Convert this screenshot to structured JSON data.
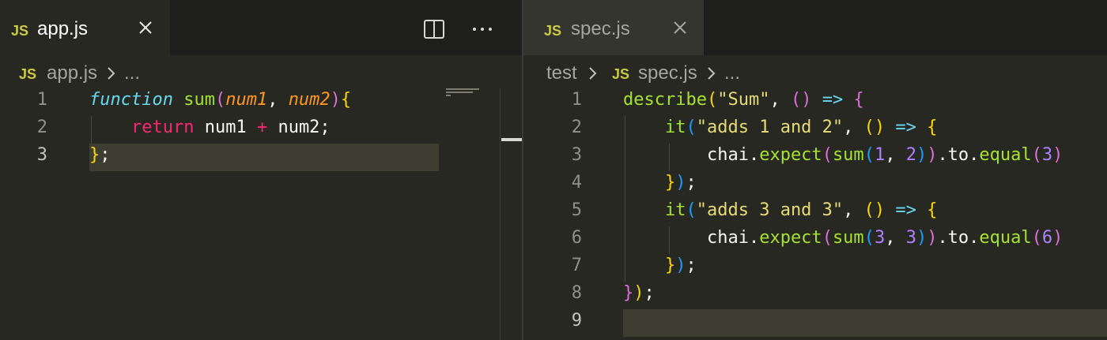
{
  "colors": {
    "editor_bg": "#272822",
    "tab_bar_bg": "#1e1f1c",
    "js_badge": "#cbcb41",
    "current_line": "#3e3d32"
  },
  "left": {
    "tab": {
      "badge": "JS",
      "title": "app.js",
      "close_icon": "close-icon"
    },
    "actions": {
      "split": "split-editor-icon",
      "more": "more-actions-icon"
    },
    "breadcrumb": {
      "badge": "JS",
      "file": "app.js",
      "ellipsis": "..."
    },
    "line_numbers": [
      "1",
      "2",
      "3"
    ],
    "code": {
      "l1": {
        "kw": "function",
        "name": " sum",
        "open": "(",
        "p1": "num1",
        "comma": ", ",
        "p2": "num2",
        "close": ")",
        "brace": "{"
      },
      "l2": {
        "indent": "    ",
        "kw": "return",
        "a": " num1 ",
        "op": "+",
        "b": " num2;"
      },
      "l3": {
        "brace": "}",
        "semi": ";"
      }
    }
  },
  "right": {
    "tab": {
      "badge": "JS",
      "title": "spec.js",
      "close_icon": "close-icon"
    },
    "breadcrumb": {
      "folder": "test",
      "badge": "JS",
      "file": "spec.js",
      "ellipsis": "..."
    },
    "line_numbers": [
      "1",
      "2",
      "3",
      "4",
      "5",
      "6",
      "7",
      "8",
      "9"
    ],
    "code": {
      "l1": {
        "fn": "describe",
        "open": "(",
        "str": "\"Sum\"",
        "comma": ", ",
        "args": "()",
        "arrow": " =>",
        "sp": " ",
        "brace": "{"
      },
      "l2": {
        "indent": "    ",
        "fn": "it",
        "open": "(",
        "str": "\"adds 1 and 2\"",
        "comma": ", ",
        "args": "()",
        "arrow": " =>",
        "sp": " ",
        "brace": "{"
      },
      "l3": {
        "indent": "        ",
        "obj": "chai.",
        "fn": "expect",
        "p1": "(",
        "fn2": "sum",
        "p2": "(",
        "n1": "1",
        "c": ", ",
        "n2": "2",
        "p2c": ")",
        "p1c": ")",
        "dot": ".to.",
        "fn3": "equal",
        "p3": "(",
        "n3": "3",
        "p3c": ")"
      },
      "l4": {
        "indent": "    ",
        "brace": "}",
        "paren": ")",
        "semi": ";"
      },
      "l5": {
        "indent": "    ",
        "fn": "it",
        "open": "(",
        "str": "\"adds 3 and 3\"",
        "comma": ", ",
        "args": "()",
        "arrow": " =>",
        "sp": " ",
        "brace": "{"
      },
      "l6": {
        "indent": "        ",
        "obj": "chai.",
        "fn": "expect",
        "p1": "(",
        "fn2": "sum",
        "p2": "(",
        "n1": "3",
        "c": ", ",
        "n2": "3",
        "p2c": ")",
        "p1c": ")",
        "dot": ".to.",
        "fn3": "equal",
        "p3": "(",
        "n3": "6",
        "p3c": ")"
      },
      "l7": {
        "indent": "    ",
        "brace": "}",
        "paren": ")",
        "semi": ";"
      },
      "l8": {
        "brace": "}",
        "paren": ")",
        "semi": ";"
      }
    }
  }
}
